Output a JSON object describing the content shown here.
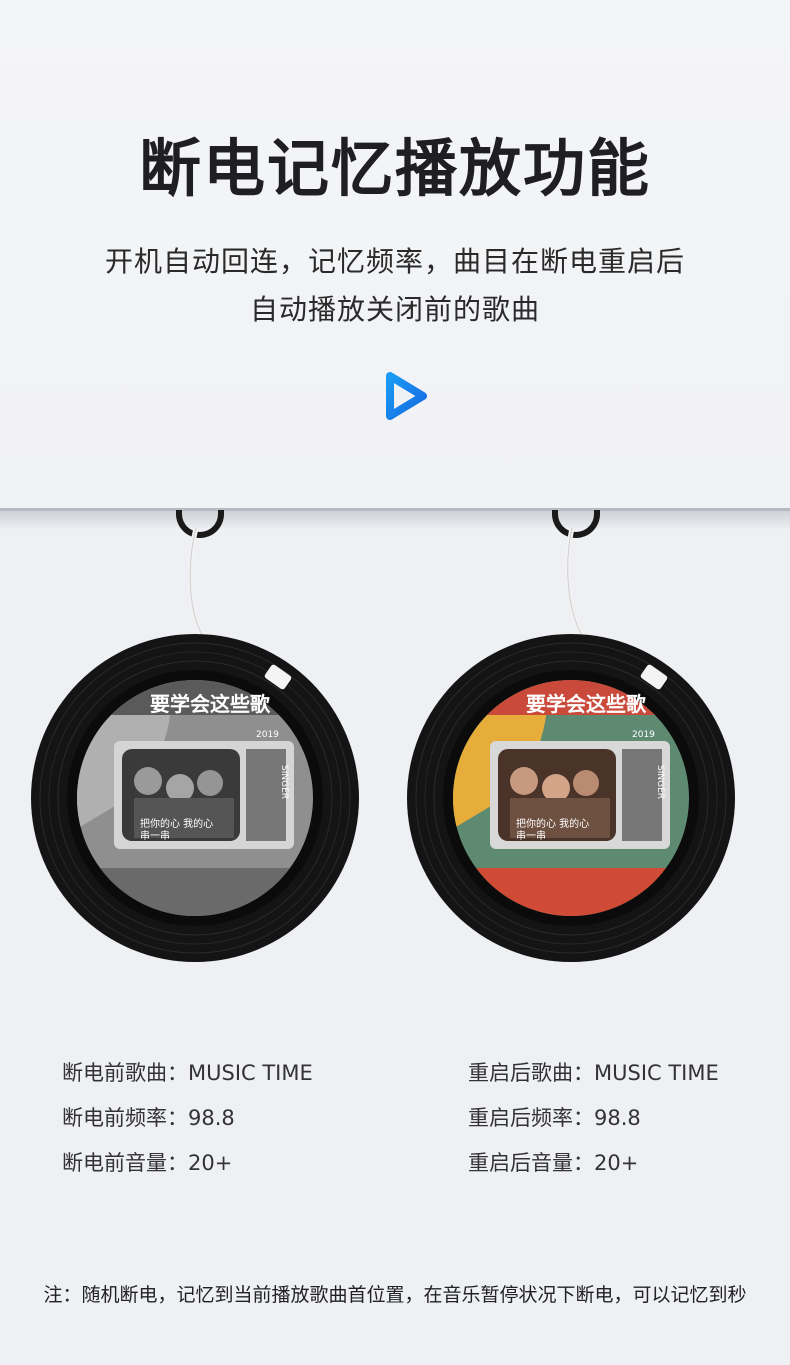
{
  "header": {
    "title": "断电记忆播放功能",
    "subtitle_line1": "开机自动回连，记忆频率，曲目在断电重启后",
    "subtitle_line2": "自动播放关闭前的歌曲",
    "play_icon": "play-triangle-icon"
  },
  "players": [
    {
      "screen_mode": "grayscale",
      "banner_text": "要学会这些歌",
      "year": "2019",
      "side_text": "SINGER",
      "caption_line1": "把你的心 我的心",
      "caption_line2": "串一串"
    },
    {
      "screen_mode": "color",
      "banner_text": "要学会这些歌",
      "year": "2019",
      "side_text": "SINGER",
      "caption_line1": "把你的心 我的心",
      "caption_line2": "串一串"
    }
  ],
  "before": {
    "song_label": "断电前歌曲：",
    "song_value": "MUSIC TIME",
    "freq_label": "断电前频率：",
    "freq_value": "98.8",
    "volume_label": "断电前音量：",
    "volume_value": "20+"
  },
  "after": {
    "song_label": "重启后歌曲：",
    "song_value": "MUSIC TIME",
    "freq_label": "重启后频率：",
    "freq_value": "98.8",
    "volume_label": "重启后音量：",
    "volume_value": "20+"
  },
  "footer": {
    "note": "注：随机断电，记忆到当前播放歌曲首位置，在音乐暂停状况下断电，可以记忆到秒"
  },
  "colors": {
    "accent_blue": "#1f8ff0",
    "vinyl_black": "#151515",
    "screen_green": "#5e8a72",
    "screen_yellow": "#e7ad3a"
  }
}
